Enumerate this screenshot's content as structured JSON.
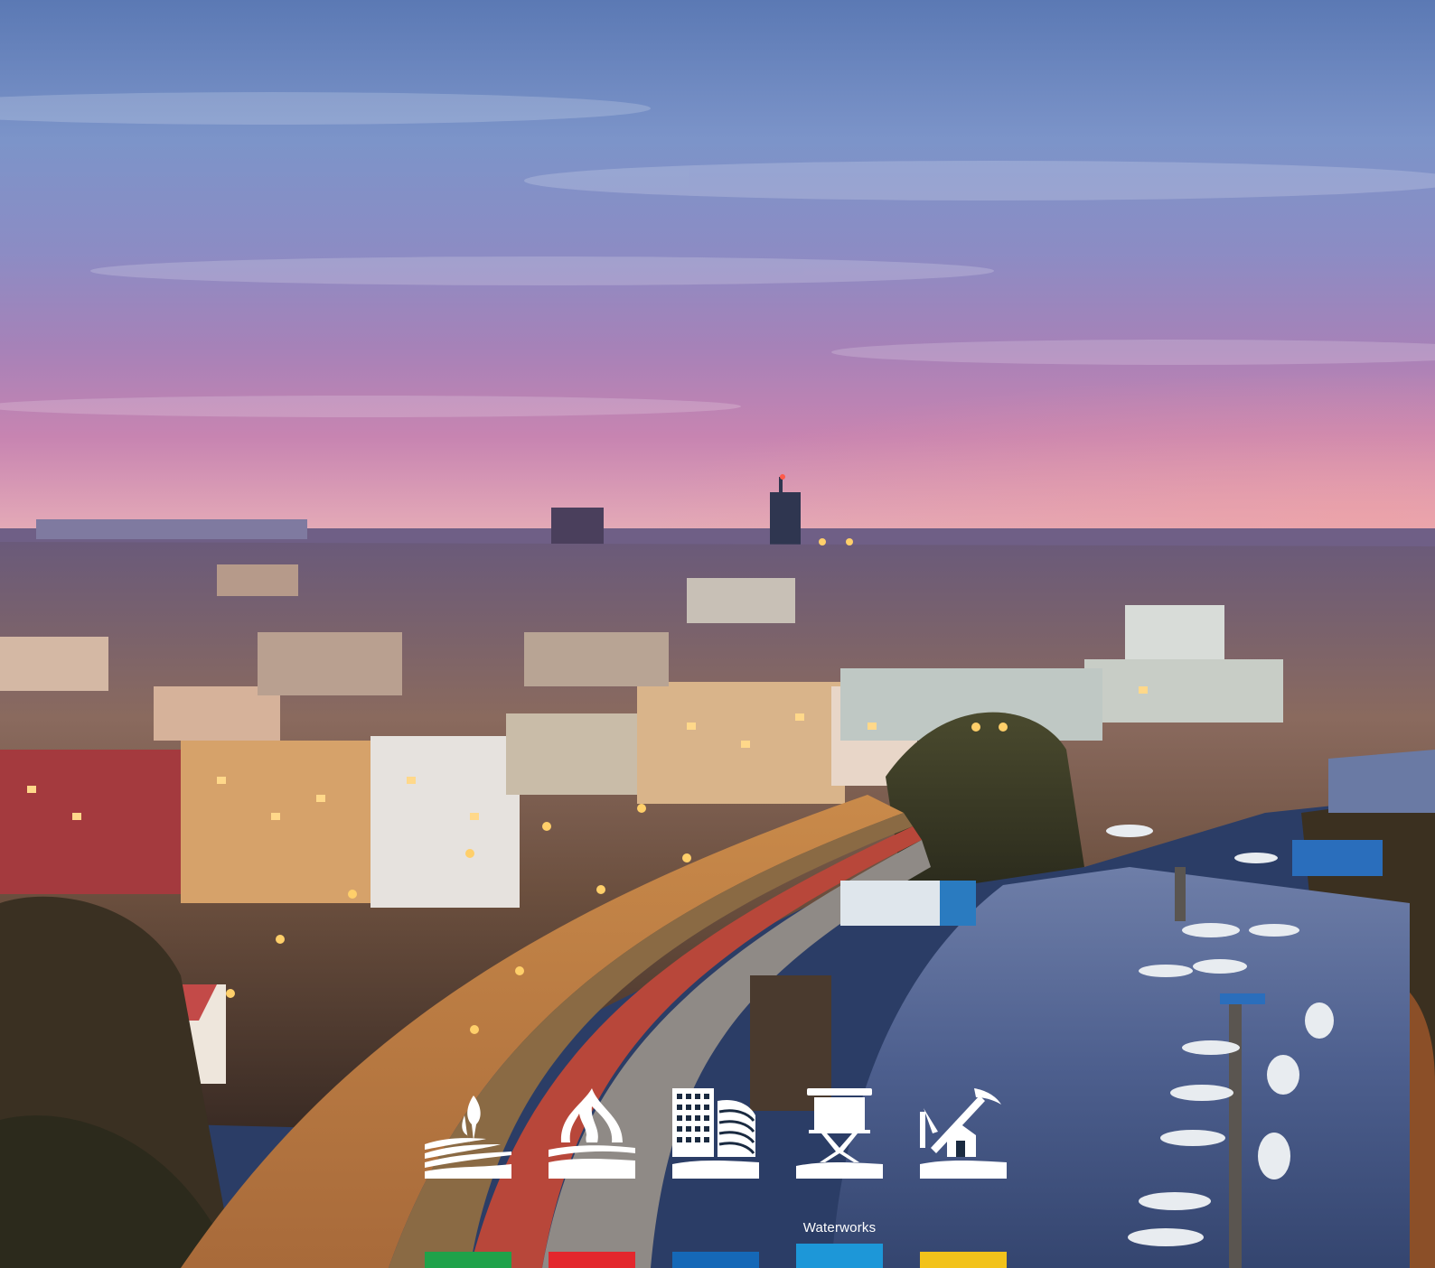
{
  "categories": [
    {
      "id": "agriculture",
      "label": "",
      "icon": "field-wheat-icon",
      "color": "#1fa24a"
    },
    {
      "id": "energy",
      "label": "",
      "icon": "flame-icon",
      "color": "#e3272d"
    },
    {
      "id": "buildings",
      "label": "",
      "icon": "buildings-icon",
      "color": "#1568b7"
    },
    {
      "id": "waterworks",
      "label": "Waterworks",
      "icon": "water-tower-icon",
      "color": "#1d97d8"
    },
    {
      "id": "mining",
      "label": "",
      "icon": "pickaxe-house-icon",
      "color": "#f2c21b"
    }
  ]
}
